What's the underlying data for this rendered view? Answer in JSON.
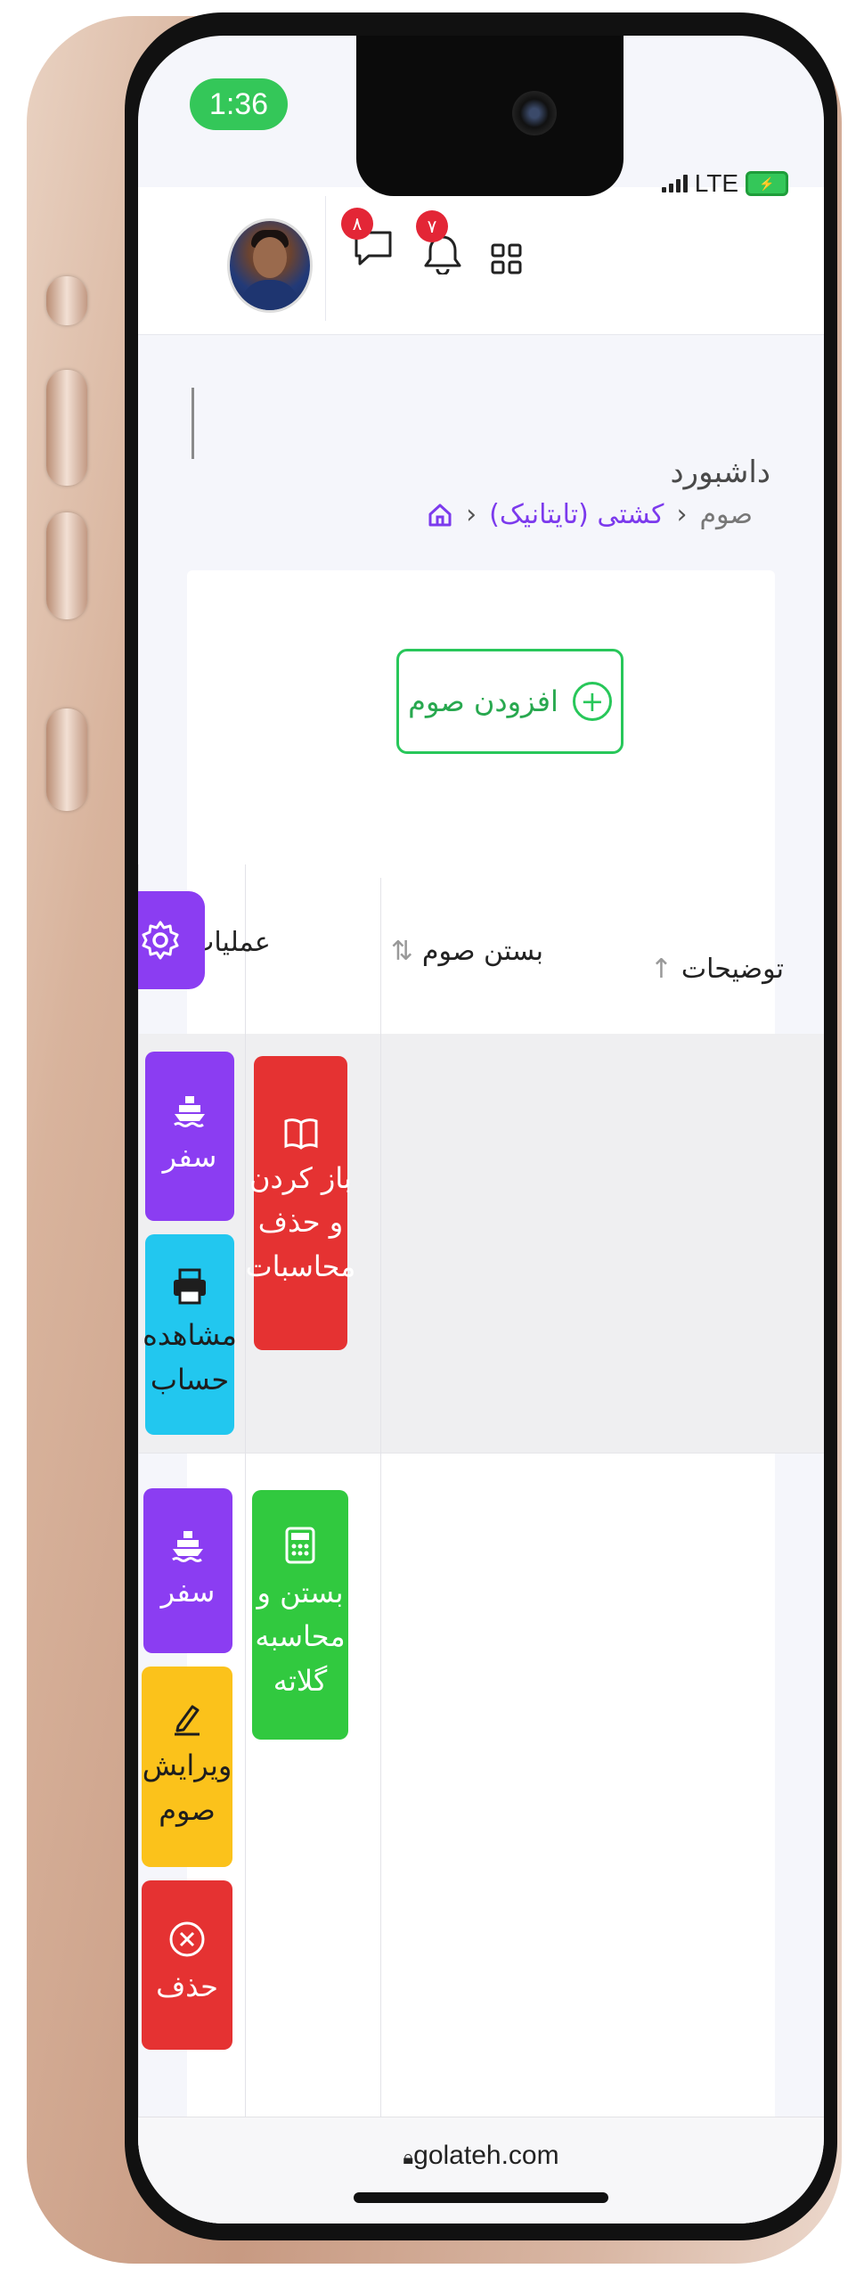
{
  "status_bar": {
    "time": "1:36",
    "network": "LTE"
  },
  "header": {
    "avatar_alt": "user avatar",
    "messages_badge": "۸",
    "notifications_badge": "۷"
  },
  "page": {
    "title": "داشبورد",
    "breadcrumb": [
      "کشتی (تایتانیک)",
      "صوم"
    ]
  },
  "toolbar": {
    "add_label": "افزودن صوم"
  },
  "table": {
    "columns": [
      "توضیحات",
      "بستن صوم",
      "عملیات"
    ],
    "rows": [
      {
        "close_action": {
          "label": "باز کردن و حذف محاسبات",
          "icon": "book-icon",
          "color": "#e53232"
        },
        "actions": [
          {
            "label": "سفر",
            "icon": "ship-icon",
            "color": "#8b3df2"
          },
          {
            "label": "مشاهده حساب",
            "icon": "printer-icon",
            "color": "#22c7ef"
          }
        ]
      },
      {
        "close_action": {
          "label": "بستن و محاسبه گلاته",
          "icon": "calculator-icon",
          "color": "#31c93f"
        },
        "actions": [
          {
            "label": "سفر",
            "icon": "ship-icon",
            "color": "#8b3df2"
          },
          {
            "label": "ویرایش صوم",
            "icon": "pen-icon",
            "color": "#fbc21b"
          },
          {
            "label": "حذف",
            "icon": "x-circle-icon",
            "color": "#e53232"
          }
        ]
      }
    ]
  },
  "browser": {
    "url": "golateh.com"
  },
  "colors": {
    "accent": "#8b3df2",
    "success": "#28c75a",
    "danger": "#e53232",
    "info": "#22c7ef",
    "warning": "#fbc21b"
  }
}
